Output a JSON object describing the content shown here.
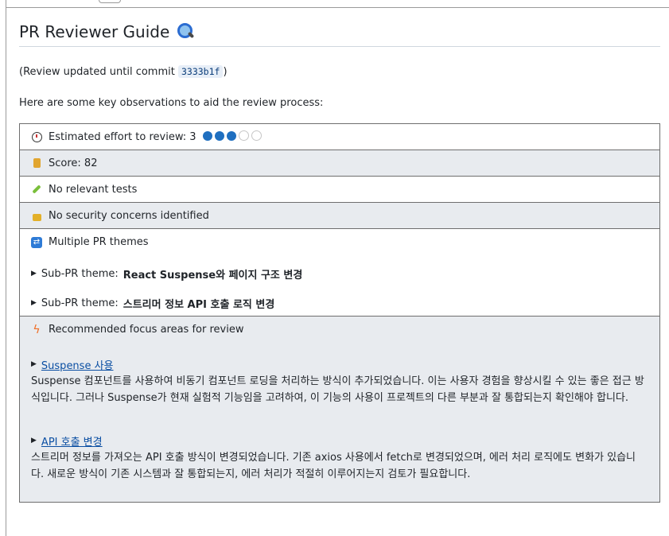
{
  "title": "PR Reviewer Guide",
  "updated": {
    "prefix": "(Review updated until commit ",
    "commit": "3333b1f",
    "suffix": ")"
  },
  "observations": "Here are some key observations to aid the review process:",
  "effort": {
    "label": "Estimated effort to review: 3",
    "value": 3,
    "max": 5
  },
  "score": {
    "label": "Score: 82"
  },
  "tests": {
    "label": "No relevant tests"
  },
  "security": {
    "label": "No security concerns identified"
  },
  "themes": {
    "label": "Multiple PR themes",
    "items": [
      {
        "prefix": "Sub-PR theme: ",
        "title": "React Suspense와 페이지 구조 변경"
      },
      {
        "prefix": "Sub-PR theme: ",
        "title": "스트리머 정보 API 호출 로직 변경"
      }
    ]
  },
  "focus": {
    "label": "Recommended focus areas for review",
    "items": [
      {
        "title": "Suspense 사용",
        "text": "Suspense 컴포넌트를 사용하여 비동기 컴포넌트 로딩을 처리하는 방식이 추가되었습니다. 이는 사용자 경험을 향상시킬 수 있는 좋은 접근 방식입니다. 그러나 Suspense가 현재 실험적 기능임을 고려하여, 이 기능의 사용이 프로젝트의 다른 부분과 잘 통합되는지 확인해야 합니다."
      },
      {
        "title": "API 호출 변경",
        "text": "스트리머 정보를 가져오는 API 호출 방식이 변경되었습니다. 기존 axios 사용에서 fetch로 변경되었으며, 에러 처리 로직에도 변화가 있습니다. 새로운 방식이 기존 시스템과 잘 통합되는지, 에러 처리가 적절히 이루어지는지 검토가 필요합니다."
      }
    ]
  },
  "colors": {
    "dot_on": "#1f6fc0",
    "link": "#0b4fa3",
    "shade": "#e8ebef"
  }
}
